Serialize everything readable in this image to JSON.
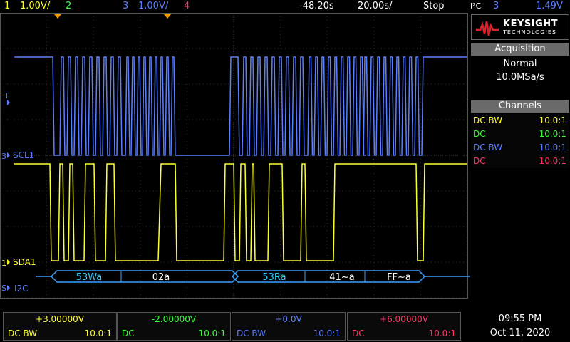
{
  "topbar": {
    "ch1_num": "1",
    "ch1_scale": "1.00V/",
    "ch2_num": "2",
    "ch3_num": "3",
    "ch3_scale": "1.00V/",
    "ch4_num": "4",
    "time_offset": "-48.20s",
    "time_scale": "20.00s/",
    "run_state": "Stop",
    "trigger_source": "I²C",
    "trigger_channel": "3",
    "trigger_level": "1.49V"
  },
  "logo": {
    "brand": "KEYSIGHT",
    "sub": "TECHNOLOGIES"
  },
  "acquisition": {
    "header": "Acquisition",
    "mode": "Normal",
    "rate": "10.0MSa/s"
  },
  "channels": {
    "header": "Channels",
    "rows": [
      {
        "coupling": "DC BW",
        "probe": "10.0:1",
        "color": "#ffff33"
      },
      {
        "coupling": "DC",
        "probe": "10.0:1",
        "color": "#33ff33"
      },
      {
        "coupling": "DC BW",
        "probe": "10.0:1",
        "color": "#5b7fff"
      },
      {
        "coupling": "DC",
        "probe": "10.0:1",
        "color": "#ff3366"
      }
    ]
  },
  "labels": {
    "scl": "SCL1",
    "sda": "SDA1",
    "bus": "I2C",
    "scl_marker": "3",
    "sda_marker": "1",
    "bus_marker": "S",
    "trig_marker": "T"
  },
  "decode": [
    {
      "text": "53Wa"
    },
    {
      "text": "02a"
    },
    {
      "text": "53Ra"
    },
    {
      "text": "41~a"
    },
    {
      "text": "FF~a"
    }
  ],
  "bottom": {
    "cells": [
      {
        "value": "+3.00000V",
        "coupling": "DC  BW",
        "probe": "10.0:1",
        "color": "#ffff33"
      },
      {
        "value": "-2.00000V",
        "coupling": "DC",
        "probe": "10.0:1",
        "color": "#33ff33"
      },
      {
        "value": "+0.0V",
        "coupling": "DC  BW",
        "probe": "10.0:1",
        "color": "#5b7fff"
      },
      {
        "value": "+6.00000V",
        "coupling": "DC",
        "probe": "10.0:1",
        "color": "#ff3366"
      }
    ],
    "time": "09:55 PM",
    "date": "Oct 11, 2020"
  }
}
